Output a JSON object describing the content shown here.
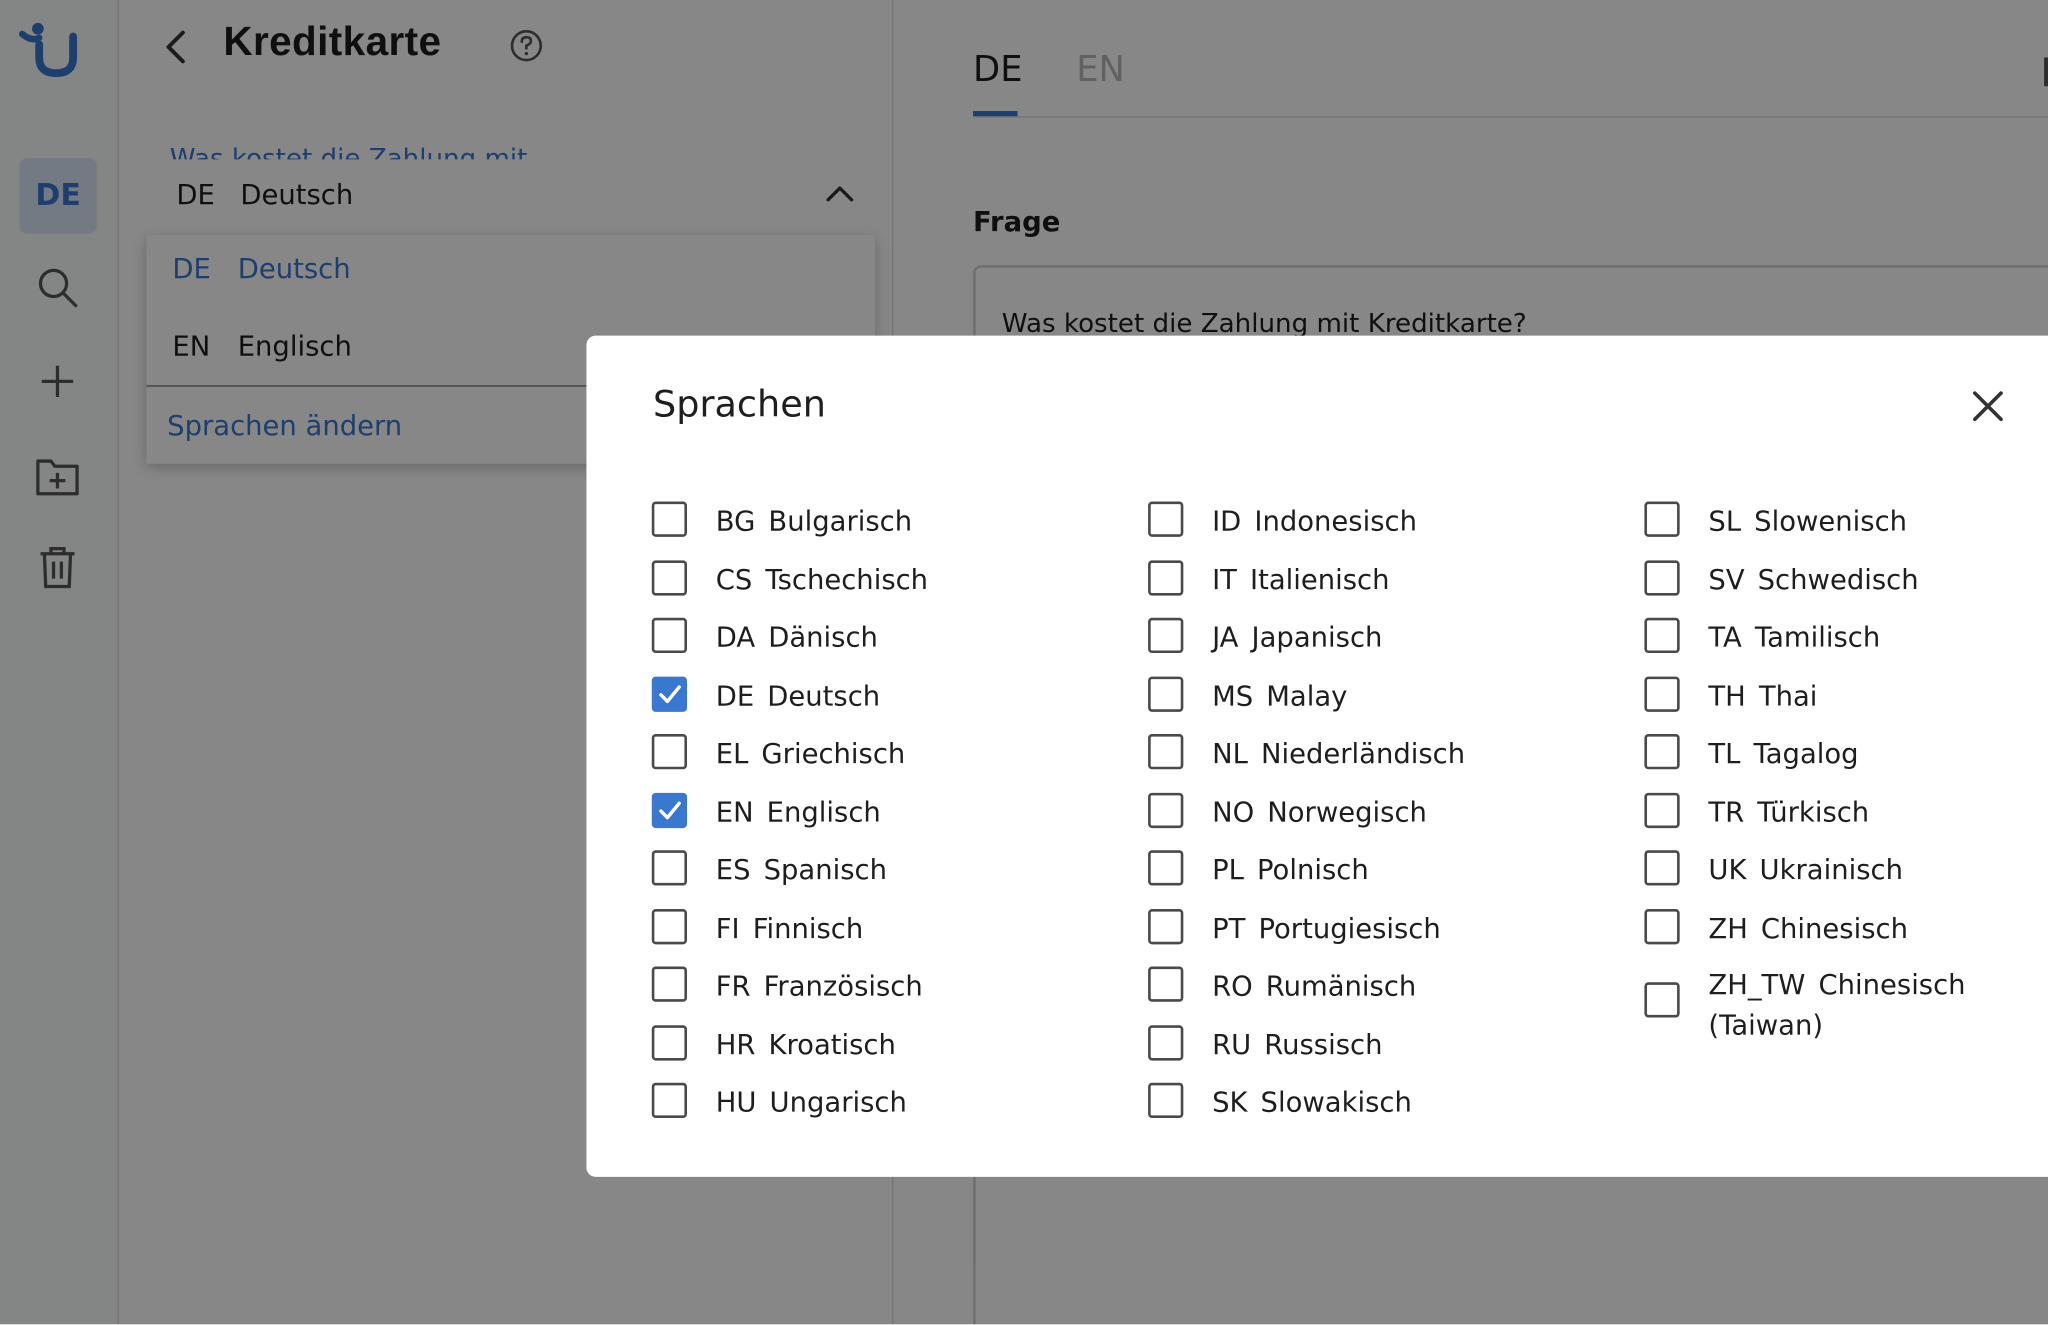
{
  "rail": {
    "language_button": "DE"
  },
  "panel": {
    "title": "Kreditkarte",
    "ghost_text": "Was kostet die Zahlung mit Kreditkarte?",
    "selected": {
      "code": "DE",
      "name": "Deutsch"
    },
    "dropdown_options": [
      {
        "code": "DE",
        "name": "Deutsch"
      },
      {
        "code": "EN",
        "name": "Englisch"
      }
    ],
    "change_languages": "Sprachen ändern"
  },
  "editor": {
    "tabs": [
      "DE",
      "EN"
    ],
    "question_label": "Frage",
    "question_text": "Was kostet die Zahlung mit Kreditkarte?"
  },
  "modal": {
    "title": "Sprachen",
    "columns": [
      [
        {
          "code": "BG",
          "name": "Bulgarisch",
          "checked": false
        },
        {
          "code": "CS",
          "name": "Tschechisch",
          "checked": false
        },
        {
          "code": "DA",
          "name": "Dänisch",
          "checked": false
        },
        {
          "code": "DE",
          "name": "Deutsch",
          "checked": true
        },
        {
          "code": "EL",
          "name": "Griechisch",
          "checked": false
        },
        {
          "code": "EN",
          "name": "Englisch",
          "checked": true
        },
        {
          "code": "ES",
          "name": "Spanisch",
          "checked": false
        },
        {
          "code": "FI",
          "name": "Finnisch",
          "checked": false
        },
        {
          "code": "FR",
          "name": "Französisch",
          "checked": false
        },
        {
          "code": "HR",
          "name": "Kroatisch",
          "checked": false
        },
        {
          "code": "HU",
          "name": "Ungarisch",
          "checked": false
        }
      ],
      [
        {
          "code": "ID",
          "name": "Indonesisch",
          "checked": false
        },
        {
          "code": "IT",
          "name": "Italienisch",
          "checked": false
        },
        {
          "code": "JA",
          "name": "Japanisch",
          "checked": false
        },
        {
          "code": "MS",
          "name": "Malay",
          "checked": false
        },
        {
          "code": "NL",
          "name": "Niederländisch",
          "checked": false
        },
        {
          "code": "NO",
          "name": "Norwegisch",
          "checked": false
        },
        {
          "code": "PL",
          "name": "Polnisch",
          "checked": false
        },
        {
          "code": "PT",
          "name": "Portugiesisch",
          "checked": false
        },
        {
          "code": "RO",
          "name": "Rumänisch",
          "checked": false
        },
        {
          "code": "RU",
          "name": "Russisch",
          "checked": false
        },
        {
          "code": "SK",
          "name": "Slowakisch",
          "checked": false
        }
      ],
      [
        {
          "code": "SL",
          "name": "Slowenisch",
          "checked": false
        },
        {
          "code": "SV",
          "name": "Schwedisch",
          "checked": false
        },
        {
          "code": "TA",
          "name": "Tamilisch",
          "checked": false
        },
        {
          "code": "TH",
          "name": "Thai",
          "checked": false
        },
        {
          "code": "TL",
          "name": "Tagalog",
          "checked": false
        },
        {
          "code": "TR",
          "name": "Türkisch",
          "checked": false
        },
        {
          "code": "UK",
          "name": "Ukrainisch",
          "checked": false
        },
        {
          "code": "ZH",
          "name": "Chinesisch",
          "checked": false
        },
        {
          "code": "ZH_TW",
          "name": "Chinesisch (Taiwan)",
          "checked": false
        }
      ]
    ]
  },
  "colors": {
    "accent": "#3a78cf",
    "overlay": "rgba(0,0,0,0.47)",
    "text": "#1e1e1e"
  }
}
